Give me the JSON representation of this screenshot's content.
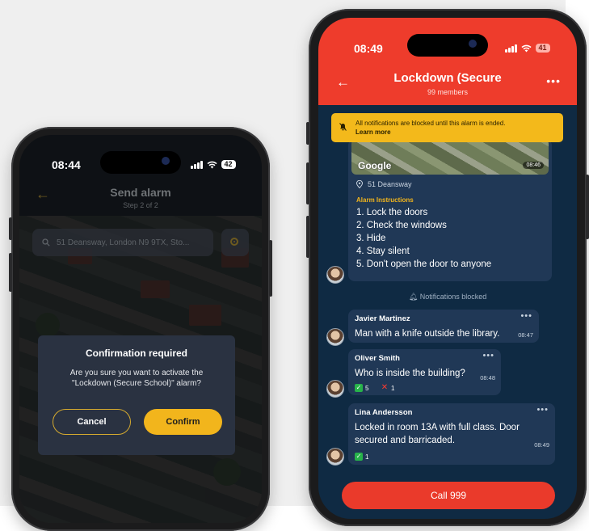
{
  "left_phone": {
    "status": {
      "time": "08:44",
      "battery": "42"
    },
    "header": {
      "title": "Send alarm",
      "step": "Step 2 of 2"
    },
    "search": {
      "value": "51 Deansway, London N9 9TX, Sto..."
    },
    "dialog": {
      "title": "Confirmation required",
      "message": "Are you sure you want to activate the \"Lockdown (Secure School)\" alarm?",
      "cancel_label": "Cancel",
      "confirm_label": "Confirm"
    }
  },
  "right_phone": {
    "status": {
      "time": "08:49",
      "battery": "41"
    },
    "header": {
      "title": "Lockdown (Secure",
      "members": "99 members"
    },
    "notice": {
      "text": "All notifications are blocked until this alarm is ended.",
      "link": "Learn more"
    },
    "alarm_card": {
      "map_logo": "Google",
      "map_time": "08:46",
      "address": "51 Deansway",
      "instructions_label": "Alarm Instructions",
      "instructions": [
        "1. Lock the doors",
        "2. Check the windows",
        "3. Hide",
        "4. Stay silent",
        "5. Don't open the door to anyone"
      ]
    },
    "blocked_label": "Notifications blocked",
    "messages": [
      {
        "sender": "Javier Martinez",
        "text": "Man with a knife outside the library.",
        "time": "08:47"
      },
      {
        "sender": "Oliver Smith",
        "text": "Who is inside the building?",
        "time": "08:48",
        "reactions": {
          "check": "5",
          "cross": "1"
        }
      },
      {
        "sender": "Lina Andersson",
        "text_line1": "Locked in room 13A with full class. Door",
        "text_line2": "secured and barricaded.",
        "time": "08:49",
        "reactions": {
          "check": "1"
        }
      }
    ],
    "call_label": "Call 999"
  },
  "colors": {
    "alarm_red": "#ee3c2c",
    "accent_yellow": "#f2b51c",
    "chat_bg": "#0f2a43",
    "bubble": "#203856"
  },
  "icons": [
    "back-arrow-icon",
    "more-icon",
    "search-icon",
    "location-target-icon",
    "bell-off-icon",
    "pin-icon",
    "check-icon",
    "cross-icon"
  ]
}
